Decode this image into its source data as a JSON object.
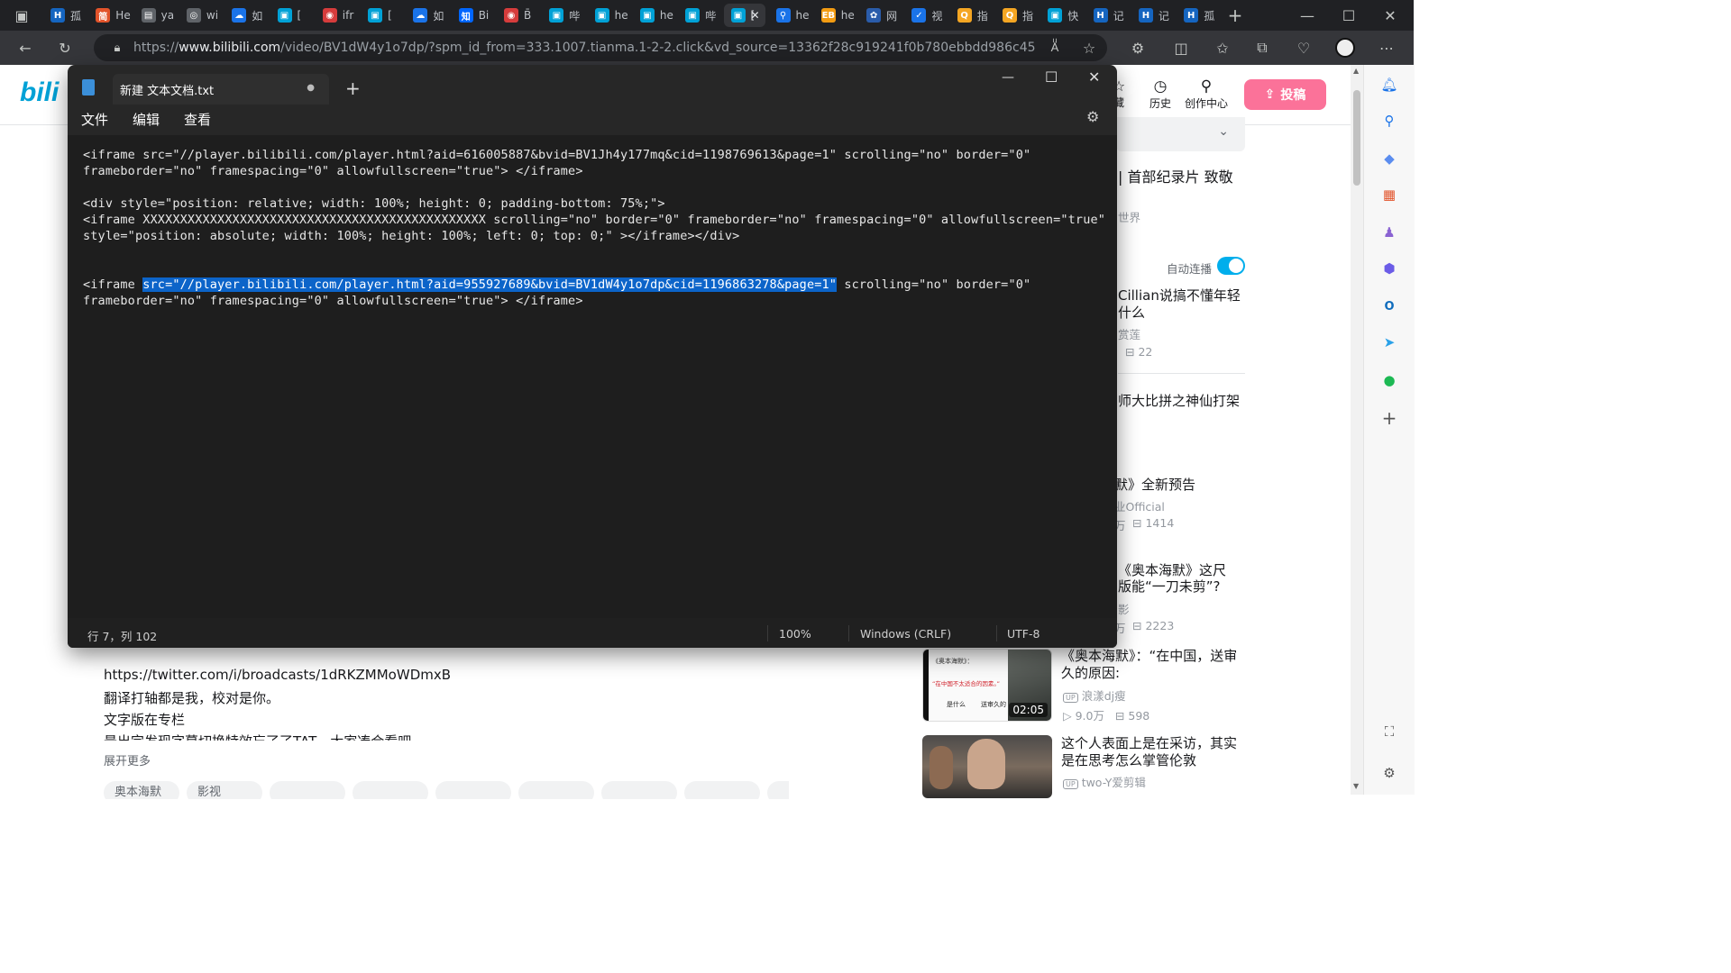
{
  "browser": {
    "tabs": [
      {
        "label": "孤",
        "icon": "H"
      },
      {
        "label": "He",
        "icon": "简"
      },
      {
        "label": "ya",
        "icon": "doc"
      },
      {
        "label": "wi",
        "icon": "link"
      },
      {
        "label": "如",
        "icon": "cloud"
      },
      {
        "label": "[",
        "icon": "tv"
      },
      {
        "label": "ifr",
        "icon": "ring"
      },
      {
        "label": "[",
        "icon": "tv"
      },
      {
        "label": "如",
        "icon": "cloud"
      },
      {
        "label": "Bi",
        "icon": "知"
      },
      {
        "label": "B̄",
        "icon": "ring"
      },
      {
        "label": "哔",
        "icon": "tv"
      },
      {
        "label": "he",
        "icon": "tv"
      },
      {
        "label": "he",
        "icon": "tv"
      },
      {
        "label": "哔",
        "icon": "tv"
      },
      {
        "label": "[",
        "icon": "tv"
      },
      {
        "label": "he",
        "icon": "search"
      },
      {
        "label": "he",
        "icon": "EB"
      },
      {
        "label": "网",
        "icon": "paw"
      },
      {
        "label": "视",
        "icon": "chart"
      },
      {
        "label": "指",
        "icon": "Q"
      },
      {
        "label": "指",
        "icon": "Q"
      },
      {
        "label": "快",
        "icon": "tv"
      },
      {
        "label": "记",
        "icon": "H"
      },
      {
        "label": "记",
        "icon": "H"
      },
      {
        "label": "孤",
        "icon": "H"
      }
    ],
    "url_prefix": "https://",
    "url_host": "www.bilibili.com",
    "url_rest": "/video/BV1dW4y1o7dp/?spm_id_from=333.1007.tianma.1-2-2.click&vd_source=13362f28c919241f0b780ebbdd986c45"
  },
  "bilibili": {
    "header": {
      "fav_label": "藏",
      "history_label": "历史",
      "creator_label": "创作中心",
      "upload_label": "投稿"
    },
    "right_fragments": {
      "f1": "| 首部纪录片 致敬",
      "f2": "世界",
      "autoplay": "自动连播",
      "f3": "Cillian说搞不懂年轻",
      "f4": "什么",
      "f5": "赏莲",
      "f6": "22",
      "f7": "师大比拼之神仙打架",
      "f8": "默》全新预告",
      "f9": "业Official",
      "f10": "万",
      "f11": "1414",
      "f12": "《奥本海默》这尺",
      "f13": "版能“一刀未剪”?",
      "f14": "影",
      "f15": "万",
      "f16": "2223"
    },
    "cards": [
      {
        "title": "《奥本海默》：“在中国，送审久的原因:",
        "author": "浪漾dj瘦",
        "views": "9.0万",
        "danmaku": "598",
        "duration": "02:05",
        "thumb_text_1": "《奥本海默》：",
        "thumb_text_2": "“在中国不太适合的因素。”",
        "thumb_text_3": "是什么",
        "thumb_text_4": "送审久的"
      },
      {
        "title": "这个人表面上是在采访，其实是在思考怎么掌管伦敦",
        "author": "two-Y爱剪辑"
      }
    ],
    "description": {
      "line1": "https://twitter.com/i/broadcasts/1dRKZMMoWDmxB",
      "line2": "翻译打轴都是我，校对是你。",
      "line3": "文字版在专栏",
      "line4": "最出完发现字幕切换特效忘了了TAT，大家凑合看吧",
      "expand": "展开更多"
    },
    "tags": [
      "奥本海默",
      "影视",
      "",
      "",
      "",
      "",
      "",
      "",
      ""
    ]
  },
  "notepad": {
    "tab_title": "新建 文本文档.txt",
    "menu": {
      "file": "文件",
      "edit": "编辑",
      "view": "查看"
    },
    "lines": [
      "<iframe src=\"//player.bilibili.com/player.html?aid=616005887&bvid=BV1Jh4y177mq&cid=1198769613&page=1\" scrolling=\"no\" border=\"0\"",
      "frameborder=\"no\" framespacing=\"0\" allowfullscreen=\"true\"> </iframe>",
      "<div style=\"position: relative; width: 100%; height: 0; padding-bottom: 75%;\">",
      "<iframe XXXXXXXXXXXXXXXXXXXXXXXXXXXXXXXXXXXXXXXXXXXXXX scrolling=\"no\" border=\"0\" frameborder=\"no\" framespacing=\"0\" allowfullscreen=\"true\"",
      "style=\"position: absolute; width: 100%; height: 100%; left: 0; top: 0;\" ></iframe></div>",
      "frameborder=\"no\" framespacing=\"0\" allowfullscreen=\"true\"> </iframe>"
    ],
    "line6_prefix": "<iframe ",
    "line6_selected": "src=\"//player.bilibili.com/player.html?aid=955927689&bvid=BV1dW4y1o7dp&cid=1196863278&page=1\"",
    "line6_suffix": " scrolling=\"no\" border=\"0\"",
    "status": {
      "position": "行 7，列 102",
      "zoom": "100%",
      "line_ending": "Windows (CRLF)",
      "encoding": "UTF-8"
    }
  }
}
